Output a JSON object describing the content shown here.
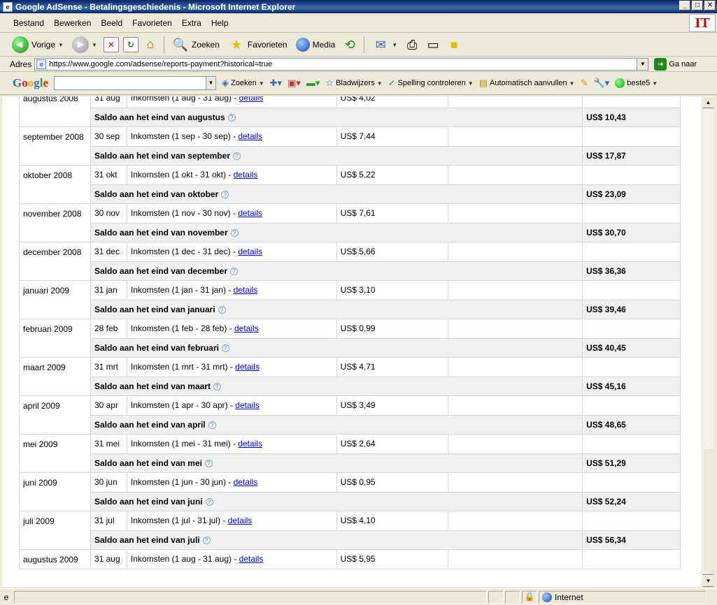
{
  "window": {
    "title": "Google AdSense - Betalingsgeschiedenis - Microsoft Internet Explorer"
  },
  "menu": [
    {
      "label": "Bestand",
      "key": "B",
      "rest": "estand"
    },
    {
      "label": "Bewerken",
      "key": "w",
      "pre": "Be",
      "rest": "erken"
    },
    {
      "label": "Beeld"
    },
    {
      "label": "Favorieten"
    },
    {
      "label": "Extra"
    },
    {
      "label": "Help"
    }
  ],
  "menu_labels": {
    "m0": "Bestand",
    "m1": "Bewerken",
    "m2": "Beeld",
    "m3": "Favorieten",
    "m4": "Extra",
    "m5": "Help"
  },
  "brand_logo": "IT",
  "toolbar": {
    "back_label": "Vorige",
    "search_label": "Zoeken",
    "favorites_label": "Favorieten",
    "media_label": "Media"
  },
  "address": {
    "label": "Adres",
    "url": "https://www.google.com/adsense/reports-payment?historical=true",
    "go_label": "Ga naar"
  },
  "google_toolbar": {
    "search_label": "Zoeken",
    "bookmarks_label": "Bladwijzers",
    "spell_label": "Spelling controleren",
    "autofill_label": "Automatisch aanvullen",
    "user_label": "beste5",
    "search_value": ""
  },
  "table": {
    "details_label": "details",
    "rows": [
      {
        "month": "augustus 2008",
        "date": "31 aug",
        "desc": "Inkomsten (1 aug - 31 aug) - ",
        "amount": "US$ 4,02",
        "balance_label": "Saldo aan het eind van augustus",
        "balance": "US$ 10,43"
      },
      {
        "month": "september 2008",
        "date": "30 sep",
        "desc": "Inkomsten (1 sep - 30 sep) - ",
        "amount": "US$ 7,44",
        "balance_label": "Saldo aan het eind van september",
        "balance": "US$ 17,87"
      },
      {
        "month": "oktober 2008",
        "date": "31 okt",
        "desc": "Inkomsten (1 okt - 31 okt) - ",
        "amount": "US$ 5,22",
        "balance_label": "Saldo aan het eind van oktober",
        "balance": "US$ 23,09"
      },
      {
        "month": "november 2008",
        "date": "30 nov",
        "desc": "Inkomsten (1 nov - 30 nov) - ",
        "amount": "US$ 7,61",
        "balance_label": "Saldo aan het eind van november",
        "balance": "US$ 30,70"
      },
      {
        "month": "december 2008",
        "date": "31 dec",
        "desc": "Inkomsten (1 dec - 31 dec) - ",
        "amount": "US$ 5,66",
        "balance_label": "Saldo aan het eind van december",
        "balance": "US$ 36,36"
      },
      {
        "month": "januari 2009",
        "date": "31 jan",
        "desc": "Inkomsten (1 jan - 31 jan) - ",
        "amount": "US$ 3,10",
        "balance_label": "Saldo aan het eind van januari",
        "balance": "US$ 39,46"
      },
      {
        "month": "februari 2009",
        "date": "28 feb",
        "desc": "Inkomsten (1 feb - 28 feb) - ",
        "amount": "US$ 0,99",
        "balance_label": "Saldo aan het eind van februari",
        "balance": "US$ 40,45"
      },
      {
        "month": "maart 2009",
        "date": "31 mrt",
        "desc": "Inkomsten (1 mrt - 31 mrt) - ",
        "amount": "US$ 4,71",
        "balance_label": "Saldo aan het eind van maart",
        "balance": "US$ 45,16"
      },
      {
        "month": "april 2009",
        "date": "30 apr",
        "desc": "Inkomsten (1 apr - 30 apr) - ",
        "amount": "US$ 3,49",
        "balance_label": "Saldo aan het eind van april",
        "balance": "US$ 48,65"
      },
      {
        "month": "mei 2009",
        "date": "31 mei",
        "desc": "Inkomsten (1 mei - 31 mei) - ",
        "amount": "US$ 2,64",
        "balance_label": "Saldo aan het eind van mei",
        "balance": "US$ 51,29"
      },
      {
        "month": "juni 2009",
        "date": "30 jun",
        "desc": "Inkomsten (1 jun - 30 jun) - ",
        "amount": "US$ 0,95",
        "balance_label": "Saldo aan het eind van juni",
        "balance": "US$ 52,24"
      },
      {
        "month": "juli 2009",
        "date": "31 jul",
        "desc": "Inkomsten (1 jul - 31 jul) - ",
        "amount": "US$ 4,10",
        "balance_label": "Saldo aan het eind van juli",
        "balance": "US$ 56,34"
      },
      {
        "month": "augustus 2009",
        "date": "31 aug",
        "desc": "Inkomsten (1 aug - 31 aug) - ",
        "amount": "US$ 5,95",
        "balance_label": "",
        "balance": ""
      }
    ]
  },
  "status": {
    "zone_label": "Internet"
  }
}
